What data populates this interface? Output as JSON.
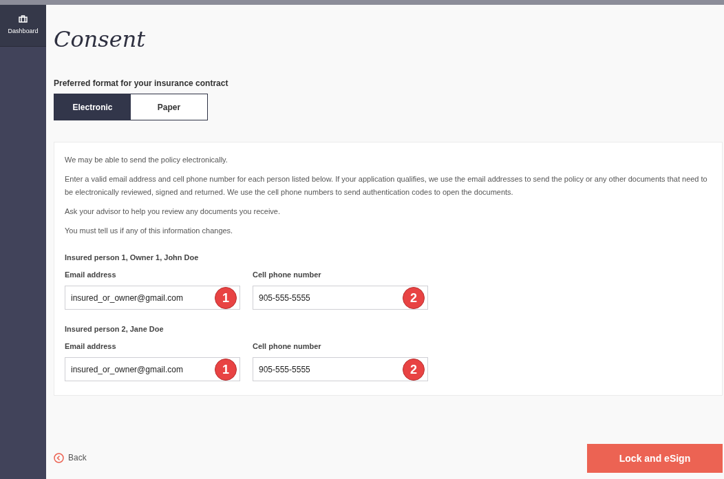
{
  "sidebar": {
    "items": [
      {
        "label": "Dashboard",
        "selected": true
      }
    ]
  },
  "title": "Consent",
  "format": {
    "label": "Preferred format for your insurance contract",
    "options": [
      {
        "label": "Electronic",
        "selected": true
      },
      {
        "label": "Paper",
        "selected": false
      }
    ]
  },
  "info": [
    "We may be able to send the policy electronically.",
    "Enter a valid email address and cell phone number for each person listed below. If your application qualifies, we use the email addresses to send the policy or any other documents that need to be electronically reviewed, signed and returned. We use the cell phone numbers to send authentication codes to open the documents.",
    "Ask your advisor to help you review any documents you receive.",
    "You must tell us if any of this information changes."
  ],
  "persons": [
    {
      "heading": "Insured person 1, Owner 1, John Doe",
      "fields": [
        {
          "label": "Email address",
          "value": "insured_or_owner@gmail.com",
          "badge": "1"
        },
        {
          "label": "Cell phone number",
          "value": "905-555-5555",
          "badge": "2"
        }
      ]
    },
    {
      "heading": "Insured person 2, Jane Doe",
      "fields": [
        {
          "label": "Email address",
          "value": "insured_or_owner@gmail.com",
          "badge": "1"
        },
        {
          "label": "Cell phone number",
          "value": "905-555-5555",
          "badge": "2"
        }
      ]
    }
  ],
  "back": "Back",
  "submit": "Lock and eSign"
}
